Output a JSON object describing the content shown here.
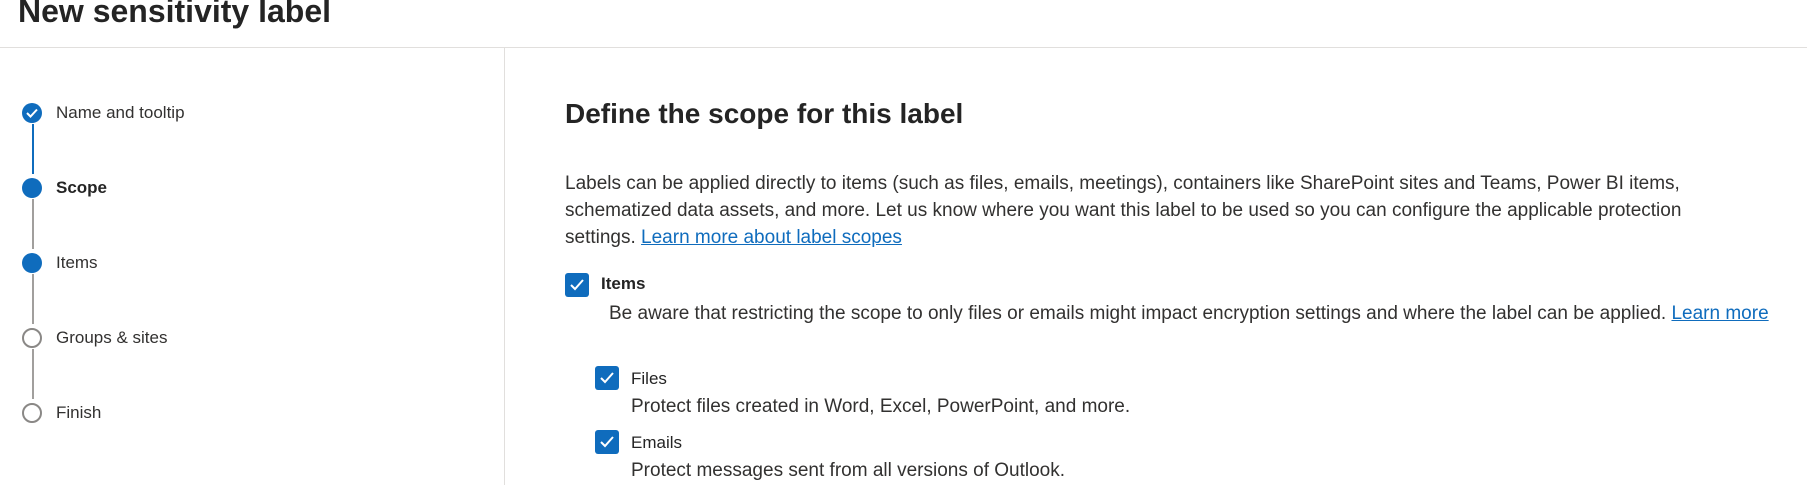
{
  "page_title": "New sensitivity label",
  "steps": [
    {
      "label": "Name and tooltip",
      "state": "completed"
    },
    {
      "label": "Scope",
      "state": "current"
    },
    {
      "label": "Items",
      "state": "pending"
    },
    {
      "label": "Groups & sites",
      "state": "not-started"
    },
    {
      "label": "Finish",
      "state": "not-started"
    }
  ],
  "main": {
    "heading": "Define the scope for this label",
    "intro_text": "Labels can be applied directly to items (such as files, emails, meetings), containers like SharePoint sites and Teams, Power BI items, schematized data assets, and more. Let us know where you want this label to be used so you can configure the applicable protection settings.",
    "intro_link": "Learn more about label scopes",
    "items_option": {
      "label": "Items",
      "checked": true,
      "description": "Be aware that restricting the scope to only files or emails might impact encryption settings and where the label can be applied.",
      "link": "Learn more",
      "sub_options": [
        {
          "label": "Files",
          "checked": true,
          "description": "Protect files created in Word, Excel, PowerPoint, and more."
        },
        {
          "label": "Emails",
          "checked": true,
          "description": "Protect messages sent from all versions of Outlook."
        }
      ]
    }
  },
  "colors": {
    "accent": "#0f6cbd",
    "text": "#323130",
    "divider": "#e1dfdd"
  }
}
